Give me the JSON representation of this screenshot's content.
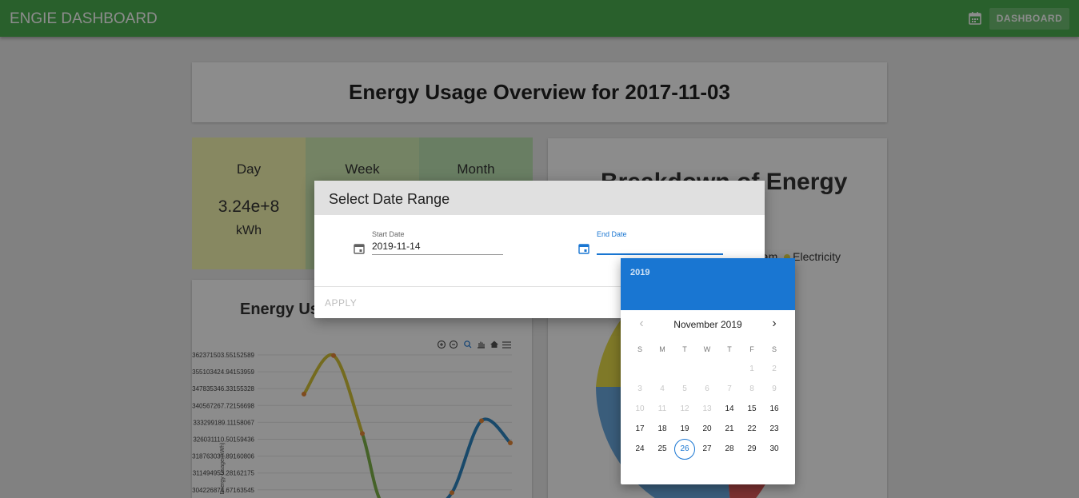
{
  "appbar": {
    "title": "ENGIE DASHBOARD",
    "dashboard_label": "DASHBOARD",
    "calendar_icon": "calendar-icon"
  },
  "overview": {
    "title": "Energy Usage Overview for 2017-11-03"
  },
  "tiles": [
    {
      "label": "Day",
      "value": "3.24e+8",
      "unit": "kWh"
    },
    {
      "label": "Week"
    },
    {
      "label": "Month"
    }
  ],
  "line_chart": {
    "title": "Energy Us"
  },
  "pie_chart": {
    "title": "Breakdown of Energy",
    "legend": [
      "eam",
      "Electricity"
    ]
  },
  "dialog": {
    "title": "Select Date Range",
    "start_label": "Start Date",
    "start_value": "2019-11-14",
    "end_label": "End Date",
    "end_value": "",
    "apply_label": "APPLY"
  },
  "picker": {
    "year": "2019",
    "month": "November 2019",
    "weekdays": [
      "S",
      "M",
      "T",
      "W",
      "T",
      "F",
      "S"
    ],
    "selected": "26",
    "min_enabled": 14,
    "leading_blanks": 5,
    "days_in_month": 30
  },
  "chart_data": {
    "type": "line",
    "title": "Energy Us",
    "ylabel": "Energy Usage (kWh)",
    "yticks": [
      "362371503.55152589",
      "355103424.94153959",
      "347835346.33155328",
      "340567267.72156698",
      "333299189.11158067",
      "326031110.50159436",
      "318763031.89160806",
      "311494953.28162175",
      "304226874.67163545"
    ],
    "ylim": [
      304226874.67,
      362371503.55
    ],
    "series": [
      {
        "values": [
          345500000,
          362100000,
          328500000,
          297000000,
          296000000,
          303000000,
          334000000,
          324500000
        ]
      }
    ],
    "colors": [
      "#d4c33a",
      "#7fb24a",
      "#2e86c1"
    ]
  },
  "colors": {
    "appbar": "#4caf50",
    "accent": "#1976d2",
    "pie_red": "#e05a5a",
    "pie_blue": "#6aa9e0",
    "pie_yellow": "#e8dc4a"
  }
}
